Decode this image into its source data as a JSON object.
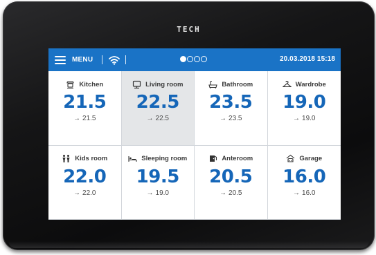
{
  "device": {
    "brand": "TECH"
  },
  "topbar": {
    "menu_label": "MENU",
    "pages": [
      true,
      false,
      false,
      false
    ],
    "datetime": "20.03.2018 15:18"
  },
  "rooms": [
    {
      "name": "Kitchen",
      "temp": "21.5",
      "setpoint": "21.5",
      "icon": "kitchen-icon",
      "selected": false
    },
    {
      "name": "Living room",
      "temp": "22.5",
      "setpoint": "22.5",
      "icon": "tv-icon",
      "selected": true
    },
    {
      "name": "Bathroom",
      "temp": "23.5",
      "setpoint": "23.5",
      "icon": "bathtub-icon",
      "selected": false
    },
    {
      "name": "Wardrobe",
      "temp": "19.0",
      "setpoint": "19.0",
      "icon": "hanger-icon",
      "selected": false
    },
    {
      "name": "Kids room",
      "temp": "22.0",
      "setpoint": "22.0",
      "icon": "kids-icon",
      "selected": false
    },
    {
      "name": "Sleeping room",
      "temp": "19.5",
      "setpoint": "19.0",
      "icon": "bed-icon",
      "selected": false
    },
    {
      "name": "Anteroom",
      "temp": "20.5",
      "setpoint": "20.5",
      "icon": "door-icon",
      "selected": false
    },
    {
      "name": "Garage",
      "temp": "16.0",
      "setpoint": "16.0",
      "icon": "garage-icon",
      "selected": false
    }
  ],
  "colors": {
    "accent": "#1a73c6",
    "temp_text": "#1566b8",
    "selected_bg": "#e4e6e8"
  }
}
